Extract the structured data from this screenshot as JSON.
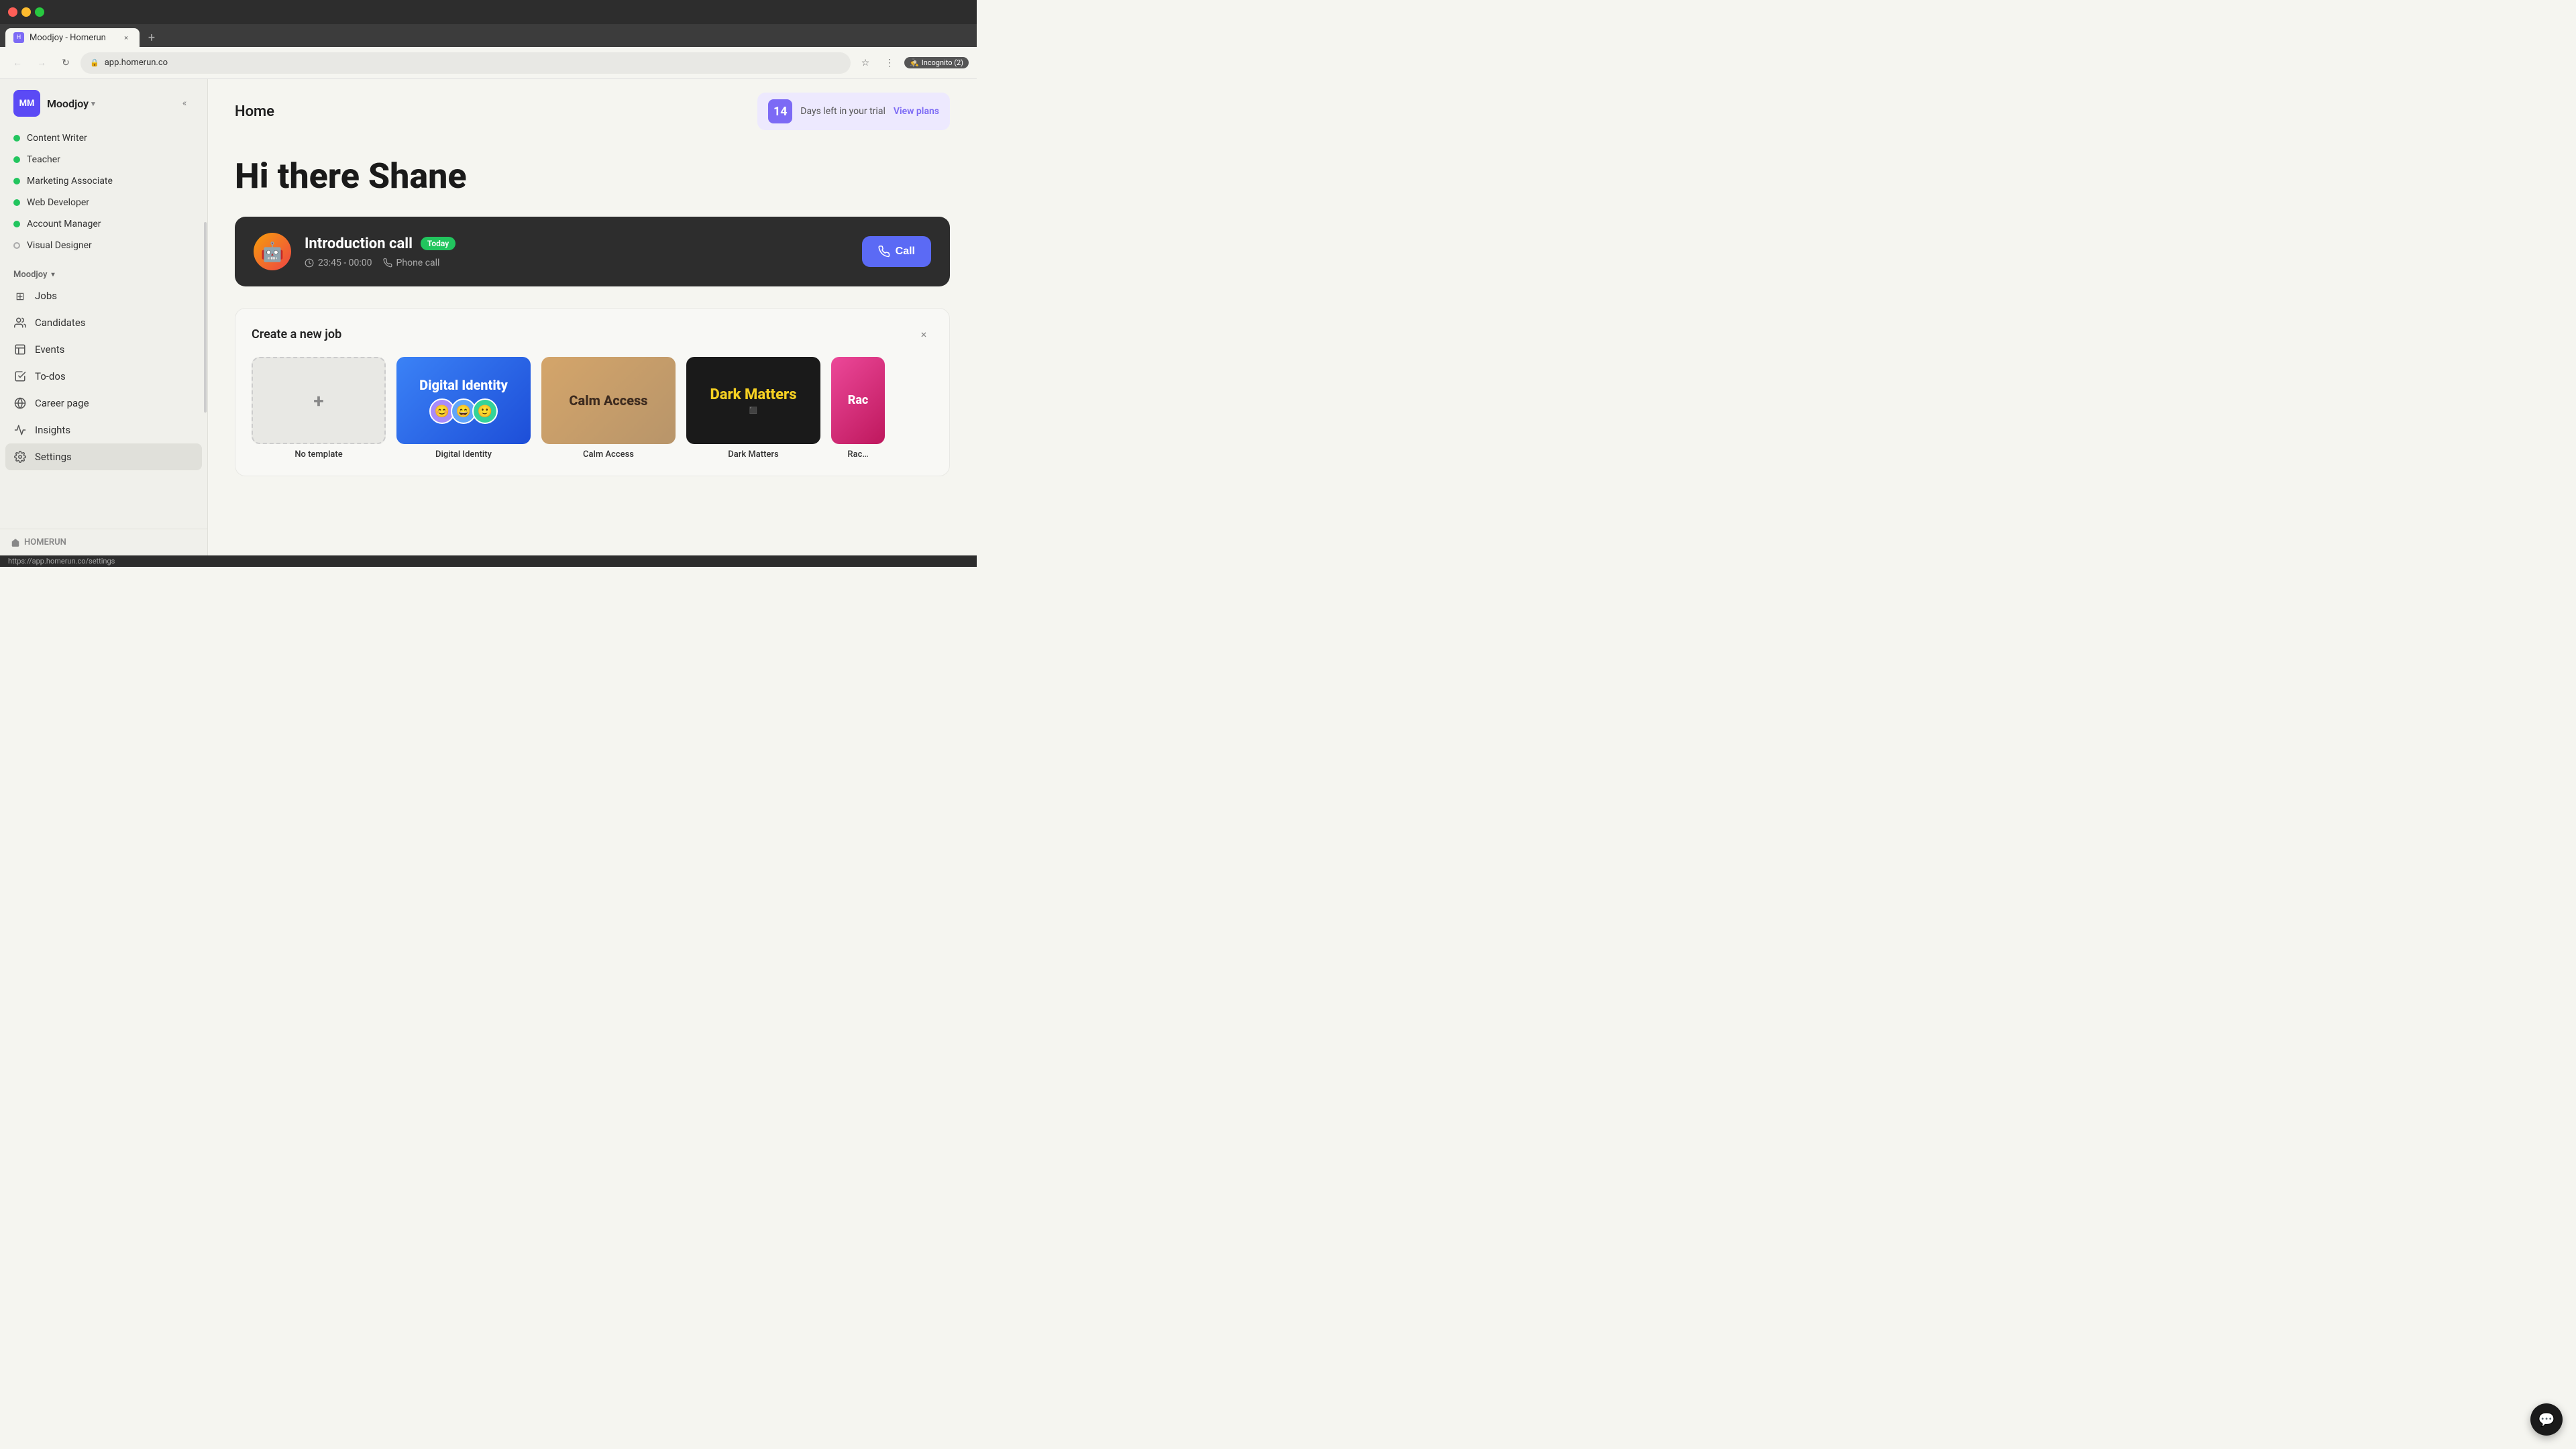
{
  "browser": {
    "tab_title": "Moodjoy - Homerun",
    "url": "app.homerun.co",
    "incognito_label": "Incognito (2)",
    "new_tab_label": "+"
  },
  "sidebar": {
    "logo_initials": "MM",
    "brand_name": "Moodjoy",
    "collapse_title": "Collapse sidebar",
    "jobs": [
      {
        "title": "Content Writer",
        "status": "active"
      },
      {
        "title": "Teacher",
        "status": "active"
      },
      {
        "title": "Marketing Associate",
        "status": "active"
      },
      {
        "title": "Web Developer",
        "status": "active"
      },
      {
        "title": "Account Manager",
        "status": "active"
      },
      {
        "title": "Visual Designer",
        "status": "inactive"
      }
    ],
    "section_label": "Moodjoy",
    "nav_items": [
      {
        "id": "jobs",
        "label": "Jobs",
        "icon": "⊞"
      },
      {
        "id": "candidates",
        "label": "Candidates",
        "icon": "👥"
      },
      {
        "id": "events",
        "label": "Events",
        "icon": "▦"
      },
      {
        "id": "todos",
        "label": "To-dos",
        "icon": "☑"
      },
      {
        "id": "career-page",
        "label": "Career page",
        "icon": "⊕"
      },
      {
        "id": "insights",
        "label": "Insights",
        "icon": "📈"
      },
      {
        "id": "settings",
        "label": "Settings",
        "icon": "⚙",
        "active": true
      }
    ],
    "footer_brand": "HOMERUN"
  },
  "header": {
    "title": "Home",
    "trial": {
      "days_num": "14",
      "text": "Days left in your trial",
      "link_label": "View plans"
    }
  },
  "main": {
    "greeting": "Hi there Shane",
    "interview_card": {
      "title": "Introduction call",
      "badge": "Today",
      "time": "23:45 - 00:00",
      "type": "Phone call",
      "call_button": "Call"
    },
    "create_job": {
      "title": "Create a new job",
      "close_label": "×",
      "templates": [
        {
          "id": "no-template",
          "label": "No template",
          "type": "empty"
        },
        {
          "id": "digital-identity",
          "label": "Digital Identity",
          "type": "digital-identity"
        },
        {
          "id": "calm-access",
          "label": "Calm Access",
          "type": "calm-access"
        },
        {
          "id": "dark-matters",
          "label": "Dark Matters",
          "type": "dark-matters"
        },
        {
          "id": "race",
          "label": "Race",
          "type": "race"
        }
      ]
    }
  },
  "status_bar": {
    "url": "https://app.homerun.co/settings"
  }
}
